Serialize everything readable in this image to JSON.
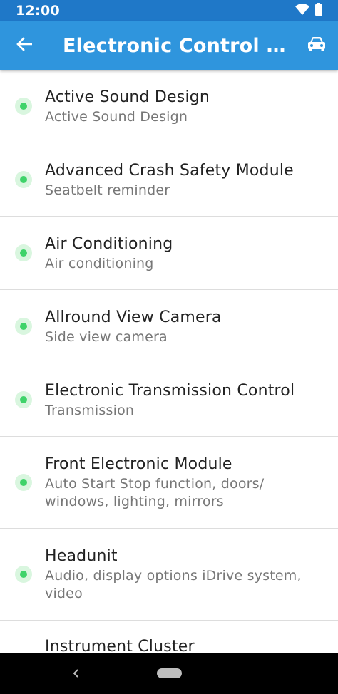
{
  "status_bar": {
    "time": "12:00",
    "icons": [
      "wifi-icon",
      "battery-icon"
    ]
  },
  "app_bar": {
    "title": "Electronic Control U…",
    "back_icon": "arrow-back-icon",
    "action_icon": "car-icon"
  },
  "colors": {
    "status_bar": "#1f78c8",
    "app_bar": "#2f95dd",
    "status_dot": "#3fd36a",
    "status_dot_halo": "#d9f6df"
  },
  "items": [
    {
      "title": "Active Sound Design",
      "subtitle": "Active Sound Design"
    },
    {
      "title": "Advanced Crash Safety Module",
      "subtitle": "Seatbelt reminder"
    },
    {
      "title": "Air Conditioning",
      "subtitle": "Air conditioning"
    },
    {
      "title": "Allround View Camera",
      "subtitle": "Side view camera"
    },
    {
      "title": "Electronic Transmission Control",
      "subtitle": "Transmission"
    },
    {
      "title": "Front Electronic Module",
      "subtitle": "Auto Start Stop function, doors/ windows, lighting, mirrors"
    },
    {
      "title": "Headunit",
      "subtitle": "Audio, display options iDrive system, video"
    },
    {
      "title": "Instrument Cluster",
      "subtitle": ""
    }
  ],
  "nav_bar": {
    "back_icon": "nav-back-icon",
    "home_icon": "nav-home-pill"
  }
}
